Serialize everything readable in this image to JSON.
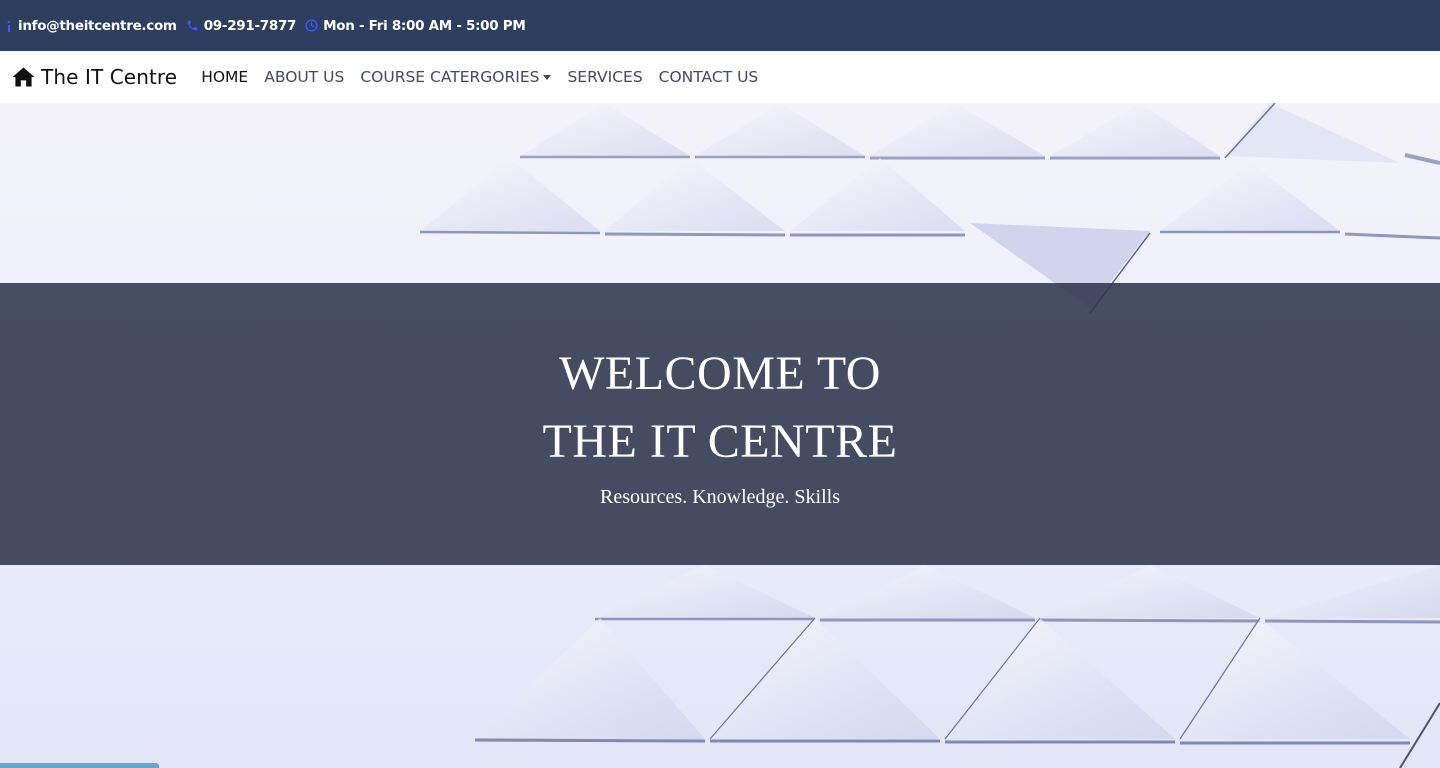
{
  "topbar": {
    "email": "info@theitcentre.com",
    "phone": "09-291-7877",
    "hours": "Mon - Fri 8:00 AM - 5:00 PM",
    "icons": [
      "info-icon",
      "phone-icon",
      "clock-icon"
    ],
    "icon_color": "#3d5afe",
    "background": "#2d3e5e"
  },
  "navbar": {
    "brand": "The IT Centre",
    "brand_icon": "home-icon",
    "links": [
      {
        "label": "HOME"
      },
      {
        "label": "ABOUT US"
      },
      {
        "label": "COURSE CATERGORIES"
      },
      {
        "label": "SERVICES"
      },
      {
        "label": "CONTACT US"
      }
    ]
  },
  "hero": {
    "title_line1": "WELCOME TO",
    "title_line2": "THE IT CENTRE",
    "subtitle": "Resources. Knowledge. Skills"
  }
}
